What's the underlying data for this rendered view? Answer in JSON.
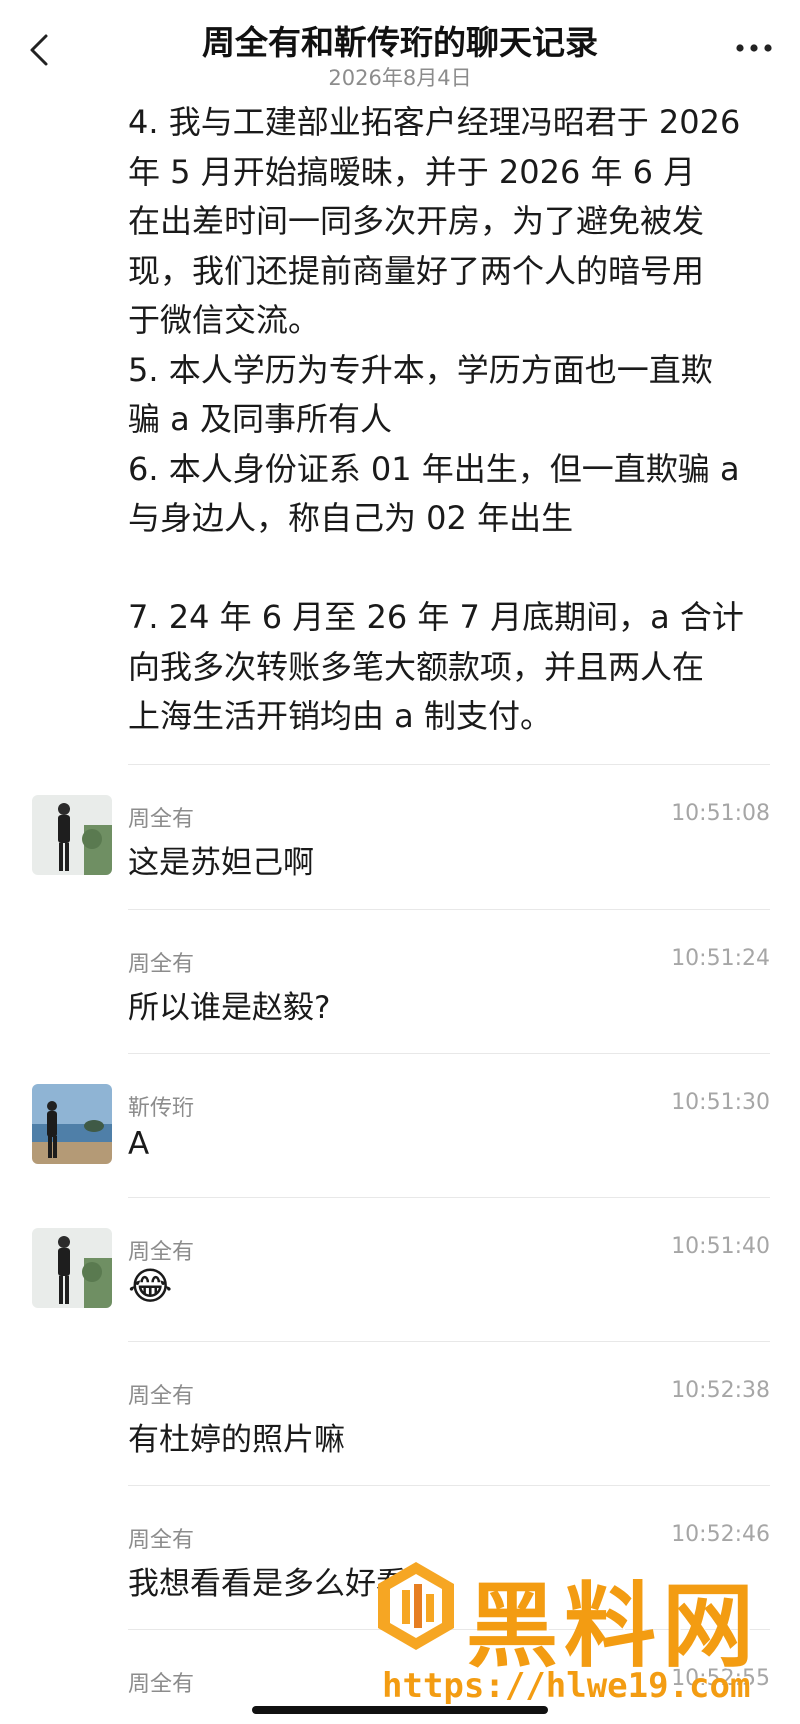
{
  "header": {
    "title": "周全有和靳传珩的聊天记录",
    "date": "2026年8月4日"
  },
  "forwarded_lines": [
    "4. 我与工建部业拓客户经理冯昭君于 2026",
    "年 5 月开始搞暧昧，并于 2026 年 6 月",
    "在出差时间一同多次开房，为了避免被发",
    "现，我们还提前商量好了两个人的暗号用",
    "于微信交流。",
    "5. 本人学历为专升本，学历方面也一直欺",
    "骗 a 及同事所有人",
    "6. 本人身份证系 01 年出生，但一直欺骗 a",
    "与身边人，称自己为 02 年出生",
    "",
    "7. 24 年 6 月至 26 年 7 月底期间，a 合计",
    "向我多次转账多笔大额款项，并且两人在",
    "上海生活开销均由 a 制支付。"
  ],
  "messages": [
    {
      "sender": "周全有",
      "time": "10:51:08",
      "text": "这是苏妲己啊"
    },
    {
      "sender": "周全有",
      "time": "10:51:24",
      "text": "所以谁是赵毅?"
    },
    {
      "sender": "靳传珩",
      "time": "10:51:30",
      "text": "A"
    },
    {
      "sender": "周全有",
      "time": "10:51:40",
      "text": "😂"
    },
    {
      "sender": "周全有",
      "time": "10:52:38",
      "text": "有杜婷的照片嘛"
    },
    {
      "sender": "周全有",
      "time": "10:52:46",
      "text": "我想看看是多么好看"
    },
    {
      "sender": "周全有",
      "time": "10:52:55",
      "text": ""
    }
  ],
  "watermark": {
    "logo_text": "黑料网",
    "url": "https://hlwe19.com"
  },
  "colors": {
    "accent": "#f39c12",
    "meta_gray": "#8c8c8c",
    "divider": "#e8e8e8"
  }
}
